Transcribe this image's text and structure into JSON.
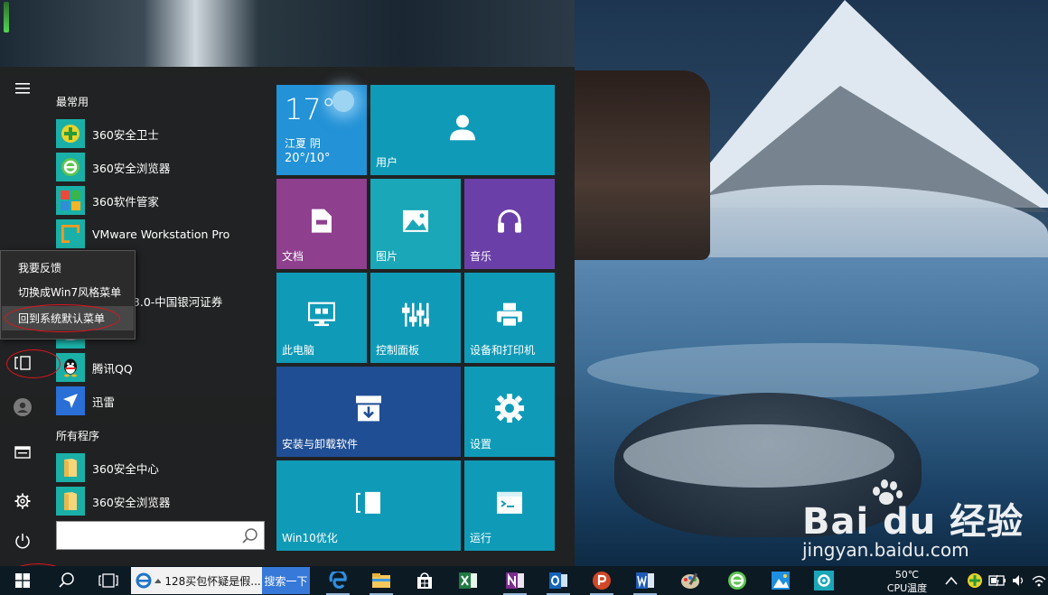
{
  "start_menu": {
    "most_used_header": "最常用",
    "all_programs_header": "所有程序",
    "apps": [
      {
        "label": "360安全卫士",
        "icon": "360-safeguard-icon"
      },
      {
        "label": "360安全浏览器",
        "icon": "360-browser-icon"
      },
      {
        "label": "360软件管家",
        "icon": "360-software-manager-icon"
      },
      {
        "label": "VMware Workstation Pro",
        "icon": "vmware-icon"
      },
      {
        "label": "融终端v3.0-中国银河证券",
        "icon": "finance-terminal-icon"
      },
      {
        "label": "",
        "icon": "cloud-app-icon"
      },
      {
        "label": "腾讯QQ",
        "icon": "qq-icon"
      },
      {
        "label": "迅雷",
        "icon": "thunder-icon"
      }
    ],
    "programs": [
      {
        "label": "360安全中心",
        "icon": "folder-icon"
      },
      {
        "label": "360安全浏览器",
        "icon": "folder-icon"
      }
    ],
    "search_placeholder": ""
  },
  "context_menu": {
    "items": [
      "我要反馈",
      "切换成Win7风格菜单",
      "回到系统默认菜单"
    ],
    "highlighted_index": 2
  },
  "tiles": {
    "weather": {
      "temp": "17°",
      "city": "江夏 阴",
      "range": "20°/10°"
    },
    "user": "用户",
    "documents": "文档",
    "pictures": "图片",
    "music": "音乐",
    "this_pc": "此电脑",
    "control_panel": "控制面板",
    "devices_printers": "设备和打印机",
    "install_uninstall": "安装与卸载软件",
    "settings": "设置",
    "win10_optimize": "Win10优化",
    "run": "运行"
  },
  "taskbar": {
    "browser_task_title": "128买包怀疑是假...",
    "search_button": "搜索一下",
    "cpu_temp_value": "50℃",
    "cpu_temp_label": "CPU温度",
    "apps": [
      "edge-icon",
      "file-explorer-icon",
      "store-icon",
      "excel-icon",
      "onenote-icon",
      "outlook-icon",
      "powerpoint-icon",
      "word-icon",
      "paint-icon",
      "360-browser-icon",
      "photos-icon",
      "settings-icon"
    ]
  },
  "watermark": {
    "main": "Bai  du 经验",
    "sub": "jingyan.baidu.com"
  },
  "colors": {
    "tile_teal": "#0f9bb7",
    "tile_purple": "#8e3f8e",
    "tile_violet": "#6b3fa8",
    "tile_dark_blue": "#1f4e94",
    "annotation_red": "#e0141e"
  }
}
